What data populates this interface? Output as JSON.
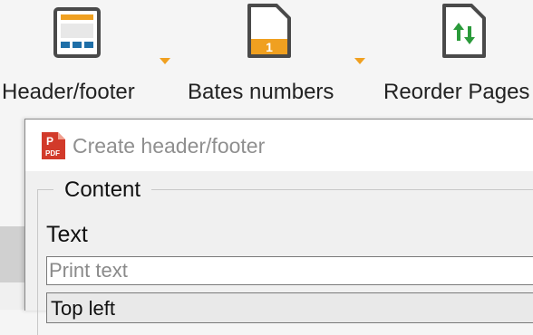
{
  "ribbon": {
    "items": [
      {
        "label": "Header/footer",
        "icon": "header-footer-icon",
        "has_dropdown": true
      },
      {
        "label": "Bates numbers",
        "icon": "bates-numbers-icon",
        "has_dropdown": true
      },
      {
        "label": "Reorder Pages",
        "icon": "reorder-pages-icon",
        "has_dropdown": false
      }
    ],
    "bates_icon_text": "1"
  },
  "dialog": {
    "title": "Create header/footer",
    "app_icon": "pdf-app-icon",
    "app_icon_text": "PDF",
    "group_label": "Content",
    "text_label": "Text",
    "text_input": {
      "value": "",
      "placeholder": "Print text"
    },
    "position_select": {
      "value": "Top left"
    }
  },
  "colors": {
    "accent_orange": "#f0a020",
    "icon_blue": "#1f6fa8",
    "icon_gray": "#4a4a4a",
    "reorder_green": "#2a9a3a",
    "pdf_red": "#d23a2a"
  }
}
